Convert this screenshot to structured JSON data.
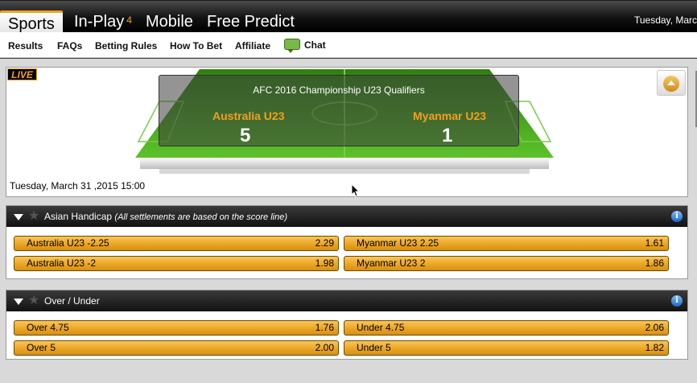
{
  "topnav": {
    "tabs": [
      {
        "label": "Sports"
      },
      {
        "label": "In-Play",
        "badge": "4"
      },
      {
        "label": "Mobile"
      },
      {
        "label": "Free Predict"
      }
    ],
    "date": "Tuesday, Marc"
  },
  "subnav": {
    "links": [
      "Results",
      "FAQs",
      "Betting Rules",
      "How To Bet",
      "Affiliate",
      "Chat"
    ]
  },
  "live": {
    "badge": "LIVE",
    "competition": "AFC 2016 Championship U23 Qualifiers",
    "home_team": "Australia U23",
    "away_team": "Myanmar U23",
    "home_score": "5",
    "away_score": "1",
    "date": "Tuesday, March 31 ,2015 15:00"
  },
  "markets": [
    {
      "title": "Asian Handicap",
      "note": "(All settlements are based on the score line)",
      "selections": [
        {
          "name": "Australia U23 -2.25",
          "odds": "2.29"
        },
        {
          "name": "Myanmar U23 2.25",
          "odds": "1.61"
        },
        {
          "name": "Australia U23 -2",
          "odds": "1.98"
        },
        {
          "name": "Myanmar U23 2",
          "odds": "1.86"
        }
      ]
    },
    {
      "title": "Over / Under",
      "note": "",
      "selections": [
        {
          "name": "Over 4.75",
          "odds": "1.76"
        },
        {
          "name": "Under 4.75",
          "odds": "2.06"
        },
        {
          "name": "Over 5",
          "odds": "2.00"
        },
        {
          "name": "Under 5",
          "odds": "1.82"
        }
      ]
    }
  ],
  "colors": {
    "accent": "#f0a020",
    "pitch": "#3f9a1a",
    "header": "#1a1a1a"
  }
}
